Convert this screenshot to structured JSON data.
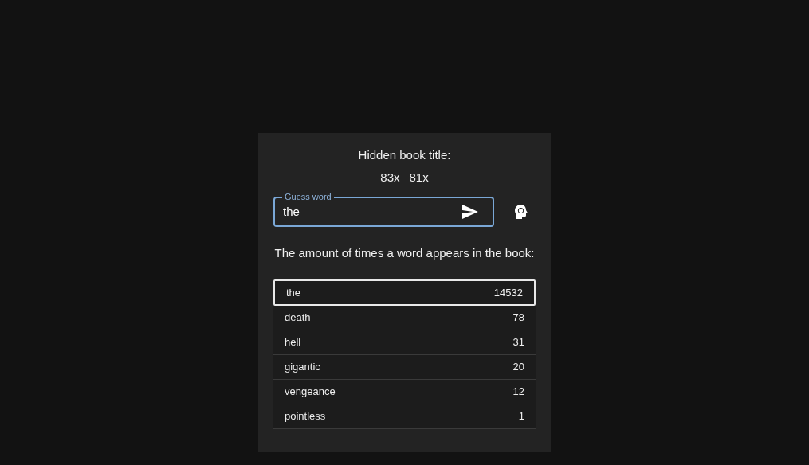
{
  "title": "Hidden book title:",
  "hidden_words": [
    "83x",
    "81x"
  ],
  "guess_field": {
    "label": "Guess word",
    "value": "the",
    "focused": true
  },
  "description": "The amount of times a word appears in the book:",
  "words": [
    {
      "word": "the",
      "count": "14532",
      "selected": true
    },
    {
      "word": "death",
      "count": "78",
      "selected": false
    },
    {
      "word": "hell",
      "count": "31",
      "selected": false
    },
    {
      "word": "gigantic",
      "count": "20",
      "selected": false
    },
    {
      "word": "vengeance",
      "count": "12",
      "selected": false
    },
    {
      "word": "pointless",
      "count": "1",
      "selected": false
    }
  ]
}
